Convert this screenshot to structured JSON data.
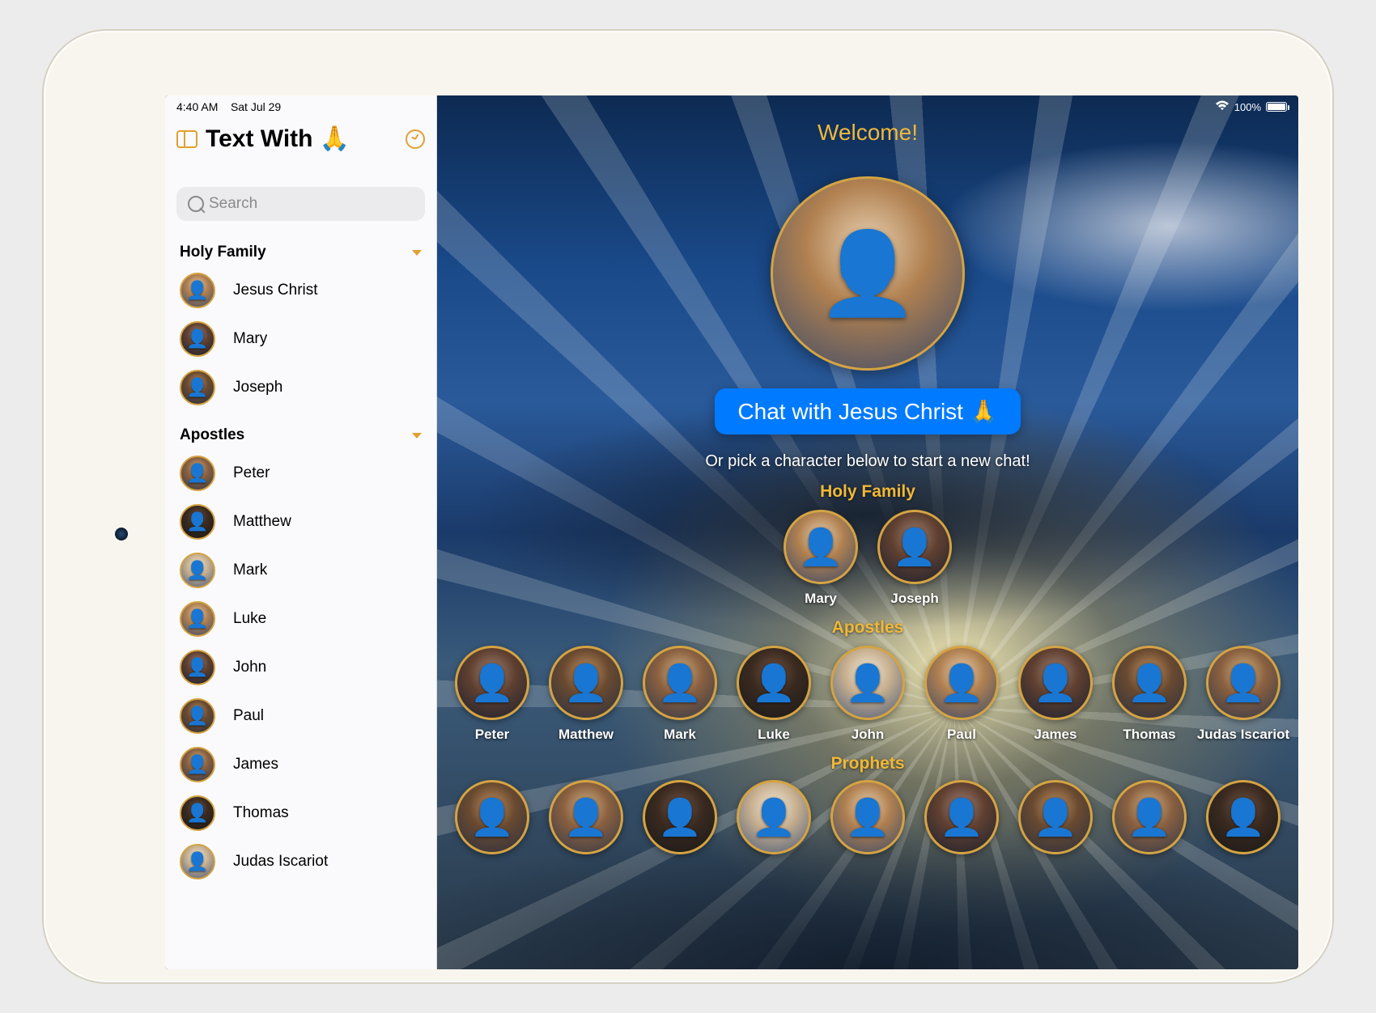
{
  "status": {
    "time": "4:40 AM",
    "date": "Sat Jul 29",
    "battery": "100%"
  },
  "app": {
    "title": "Text With 🙏"
  },
  "search": {
    "placeholder": "Search"
  },
  "sidebar": {
    "sections": [
      {
        "title": "Holy Family",
        "items": [
          {
            "name": "Jesus Christ"
          },
          {
            "name": "Mary"
          },
          {
            "name": "Joseph"
          }
        ]
      },
      {
        "title": "Apostles",
        "items": [
          {
            "name": "Peter"
          },
          {
            "name": "Matthew"
          },
          {
            "name": "Mark"
          },
          {
            "name": "Luke"
          },
          {
            "name": "John"
          },
          {
            "name": "Paul"
          },
          {
            "name": "James"
          },
          {
            "name": "Thomas"
          },
          {
            "name": "Judas Iscariot"
          }
        ]
      }
    ]
  },
  "main": {
    "welcome": "Welcome!",
    "cta": "Chat with Jesus Christ 🙏",
    "subtitle": "Or pick a character below to start a new chat!",
    "groups": [
      {
        "title": "Holy Family",
        "characters": [
          {
            "name": "Mary"
          },
          {
            "name": "Joseph"
          }
        ]
      },
      {
        "title": "Apostles",
        "characters": [
          {
            "name": "Peter"
          },
          {
            "name": "Matthew"
          },
          {
            "name": "Mark"
          },
          {
            "name": "Luke"
          },
          {
            "name": "John"
          },
          {
            "name": "Paul"
          },
          {
            "name": "James"
          },
          {
            "name": "Thomas"
          },
          {
            "name": "Judas Iscariot"
          }
        ]
      },
      {
        "title": "Prophets",
        "characters": [
          {
            "name": ""
          },
          {
            "name": ""
          },
          {
            "name": ""
          },
          {
            "name": ""
          },
          {
            "name": ""
          },
          {
            "name": ""
          },
          {
            "name": ""
          },
          {
            "name": ""
          },
          {
            "name": ""
          }
        ]
      }
    ]
  }
}
